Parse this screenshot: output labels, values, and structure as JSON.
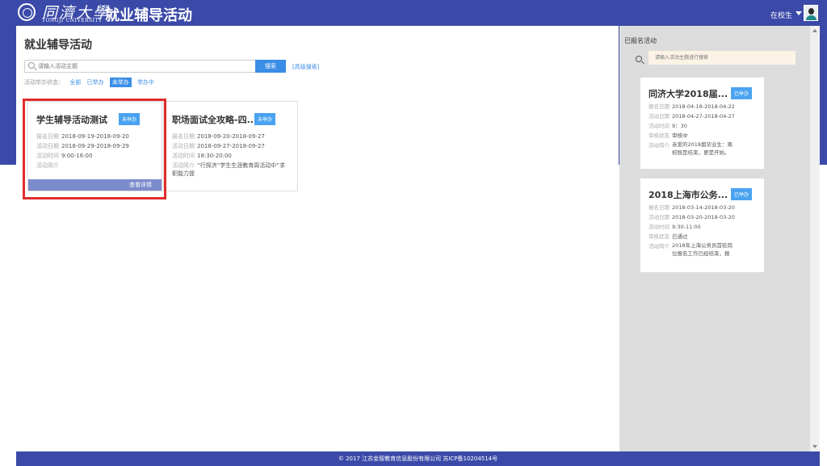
{
  "header": {
    "logo_cn": "同濟大學",
    "logo_en": "TONGJI UNIVERSITY",
    "title": "就业辅导活动",
    "user_role": "在校生"
  },
  "main": {
    "page_title": "就业辅导活动",
    "search_placeholder": "请输入活动主题",
    "search_button": "搜索",
    "advanced_search": "[高级搜索]",
    "filter_label": "活动举办状态：",
    "filters": [
      "全部",
      "已举办",
      "未举办",
      "举办中"
    ],
    "active_filter": "未举办",
    "cards": [
      {
        "title": "学生辅导活动测试",
        "status": "未举办",
        "reg_label": "报名日期",
        "reg_date": "2018-09-19-2018-09-20",
        "act_label": "活动日期",
        "act_date": "2018-09-29-2018-09-29",
        "time_label": "活动时间",
        "time": "9:00-16:00",
        "intro_label": "活动简介",
        "intro": "",
        "detail_button": "查看详情"
      },
      {
        "title": "职场面试全攻略-四...",
        "status": "未举办",
        "reg_label": "报名日期",
        "reg_date": "2018-09-20-2018-09-27",
        "act_label": "活动日期",
        "act_date": "2018-09-27-2018-09-27",
        "time_label": "活动时间",
        "time": "18:30-20:00",
        "intro_label": "活动简介",
        "intro": "“行探济”学生生涯教育周活动中“求职能力提"
      }
    ]
  },
  "sidebar": {
    "title": "已报名活动",
    "search_placeholder": "请输入活动主题进行搜索",
    "items": [
      {
        "title": "同济大学2018届...",
        "status": "已举办",
        "reg_label": "报名日期",
        "reg_date": "2018-04-18-2018-04-22",
        "act_label": "活动日期",
        "act_date": "2018-04-27-2018-04-27",
        "time_label": "活动时间",
        "time": "9：30",
        "review_label": "审核状态",
        "review": "审核中",
        "intro_label": "活动简介",
        "intro": "亲爱的2018届毕业生：离校既是结束，更是开始。"
      },
      {
        "title": "2018上海市公务...",
        "status": "已举办",
        "reg_label": "报名日期",
        "reg_date": "2018-03-14-2018-03-20",
        "act_label": "活动日期",
        "act_date": "2018-03-20-2018-03-20",
        "time_label": "活动时间",
        "time": "9:30-11:00",
        "review_label": "审核状态",
        "review": "已通过",
        "intro_label": "活动简介",
        "intro": "2018年上海公务员首轮岗位报名工作已经结束，报"
      }
    ]
  },
  "footer": {
    "text": "© 2017 江苏金智教育信息股份有限公司 苏ICP备10204514号"
  },
  "colors": {
    "brand": "#3b4aa8",
    "accent": "#3b8de6",
    "badge": "#4aa3f0",
    "highlight": "#e02d2d",
    "detail_button": "#7b8bcc"
  }
}
